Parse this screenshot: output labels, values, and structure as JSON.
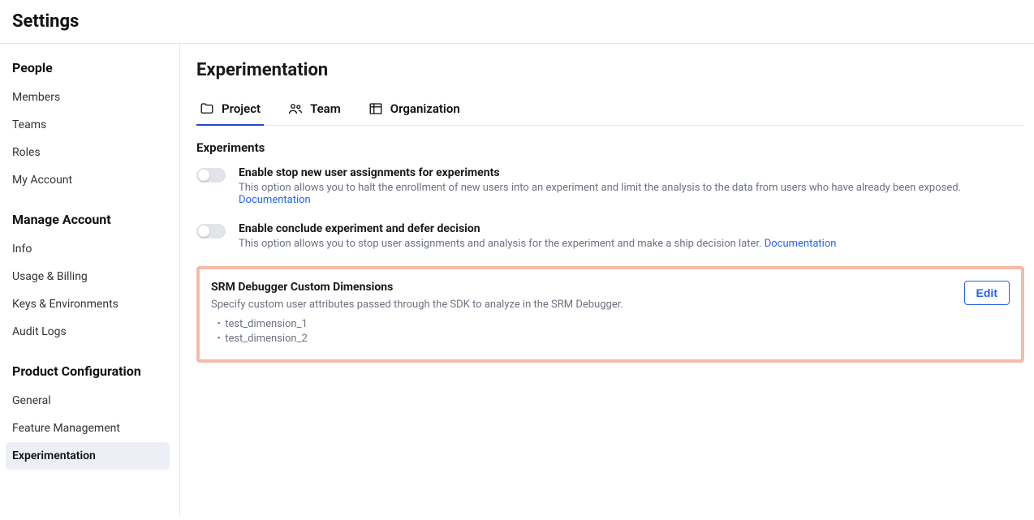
{
  "header": {
    "title": "Settings"
  },
  "sidebar": {
    "groups": [
      {
        "title": "People",
        "items": [
          {
            "label": "Members",
            "active": false
          },
          {
            "label": "Teams",
            "active": false
          },
          {
            "label": "Roles",
            "active": false
          },
          {
            "label": "My Account",
            "active": false
          }
        ]
      },
      {
        "title": "Manage Account",
        "items": [
          {
            "label": "Info",
            "active": false
          },
          {
            "label": "Usage & Billing",
            "active": false
          },
          {
            "label": "Keys & Environments",
            "active": false
          },
          {
            "label": "Audit Logs",
            "active": false
          }
        ]
      },
      {
        "title": "Product Configuration",
        "items": [
          {
            "label": "General",
            "active": false
          },
          {
            "label": "Feature Management",
            "active": false
          },
          {
            "label": "Experimentation",
            "active": true
          }
        ]
      }
    ]
  },
  "main": {
    "title": "Experimentation",
    "tabs": [
      {
        "label": "Project",
        "icon": "folder",
        "active": true
      },
      {
        "label": "Team",
        "icon": "team",
        "active": false
      },
      {
        "label": "Organization",
        "icon": "org",
        "active": false
      }
    ],
    "section_title": "Experiments",
    "settings": [
      {
        "title": "Enable stop new user assignments for experiments",
        "desc": "This option allows you to halt the enrollment of new users into an experiment and limit the analysis to the data from users who have already been exposed.",
        "doc": "Documentation"
      },
      {
        "title": "Enable conclude experiment and defer decision",
        "desc": "This option allows you to stop user assignments and analysis for the experiment and make a ship decision later.",
        "doc": "Documentation"
      }
    ],
    "panel": {
      "title": "SRM Debugger Custom Dimensions",
      "desc": "Specify custom user attributes passed through the SDK to analyze in the SRM Debugger.",
      "items": [
        "test_dimension_1",
        "test_dimension_2"
      ],
      "edit": "Edit"
    }
  }
}
